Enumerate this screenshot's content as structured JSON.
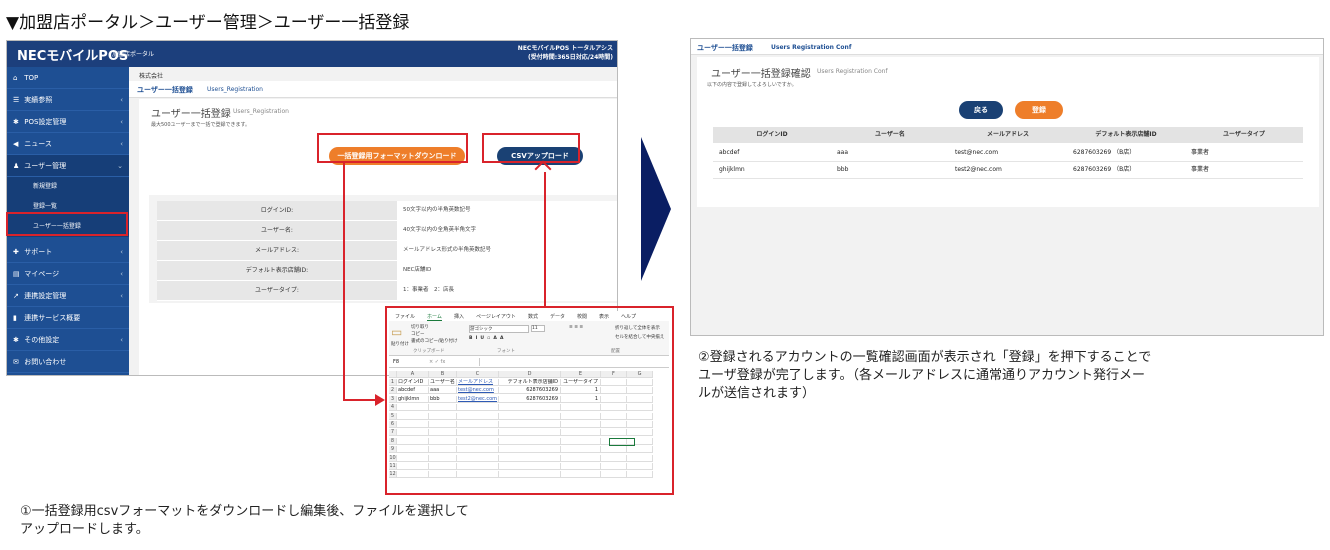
{
  "page_title": "▼加盟店ポータル＞ユーザー管理＞ユーザー一括登録",
  "left_app": {
    "logo": "NECモバイルPOS",
    "logo_sub": "加盟店ポータル",
    "top_right_line1": "NECモバイルPOS トータルアシス",
    "top_right_line2": "(受付時間:365日対応/24時間)",
    "sidebar": [
      {
        "icon": "home-icon",
        "glyph": "⌂",
        "label": "TOP",
        "chevron": ""
      },
      {
        "icon": "list-icon",
        "glyph": "☰",
        "label": "実績参照",
        "chevron": "‹"
      },
      {
        "icon": "gear-icon",
        "glyph": "✱",
        "label": "POS設定管理",
        "chevron": "‹"
      },
      {
        "icon": "megaphone-icon",
        "glyph": "◀",
        "label": "ニュース",
        "chevron": "‹"
      },
      {
        "icon": "users-icon",
        "glyph": "♟",
        "label": "ユーザー管理",
        "chevron": "⌄"
      }
    ],
    "sidebar_sub": [
      "新規登録",
      "登録一覧",
      "ユーザー一括登録"
    ],
    "sidebar_bottom": [
      {
        "icon": "support-icon",
        "glyph": "✚",
        "label": "サポート",
        "chevron": "‹"
      },
      {
        "icon": "id-card-icon",
        "glyph": "▤",
        "label": "マイページ",
        "chevron": "‹"
      },
      {
        "icon": "external-link-icon",
        "glyph": "↗",
        "label": "連携設定管理",
        "chevron": "‹"
      },
      {
        "icon": "document-icon",
        "glyph": "▮",
        "label": "連携サービス概要",
        "chevron": ""
      },
      {
        "icon": "gear-icon",
        "glyph": "✱",
        "label": "その他設定",
        "chevron": "‹"
      },
      {
        "icon": "mail-icon",
        "glyph": "✉",
        "label": "お問い合わせ",
        "chevron": ""
      }
    ],
    "company": "株式会社",
    "breadcrumb_main": "ユーザー一括登録",
    "breadcrumb_sub": "Users_Registration",
    "heading": "ユーザー一括登録",
    "heading_sub": "Users_Registration",
    "description": "最大500ユーザーまで一括で登録できます。",
    "btn_download": "一括登録用フォーマットダウンロード",
    "btn_csv": "CSVアップロード",
    "spec_rows": [
      {
        "label": "ログインID:",
        "value": "50文字以内の半角英数記号"
      },
      {
        "label": "ユーザー名:",
        "value": "40文字以内の全角英半角文字"
      },
      {
        "label": "メールアドレス:",
        "value": "メールアドレス形式の半角英数記号"
      },
      {
        "label": "デフォルト表示店舗ID:",
        "value": "NEC店舗ID"
      },
      {
        "label": "ユーザータイプ:",
        "value": "1：事業者　2：店長"
      }
    ]
  },
  "excel": {
    "tabs": [
      "ファイル",
      "ホーム",
      "挿入",
      "ページレイアウト",
      "数式",
      "データ",
      "校閲",
      "表示",
      "ヘルプ"
    ],
    "ribbon": {
      "cut": "切り取り",
      "copy": "コピー",
      "format_painter": "書式のコピー/貼り付け",
      "paste": "貼り付け",
      "clipboard": "クリップボード",
      "font_name": "游ゴシック",
      "font_size": "11",
      "font_group": "フォント",
      "wrap": "折り返して全体を表示",
      "merge": "セルを結合して中央揃え",
      "align_group": "配置"
    },
    "name_box": "F8",
    "formula_icons": "× ✓ fx",
    "columns": [
      "",
      "A",
      "B",
      "C",
      "D",
      "E",
      "F",
      "G"
    ],
    "rows": [
      [
        "1",
        "ログインID",
        "ユーザー名",
        "メールアドレス",
        "デフォルト表示店舗ID",
        "ユーザータイプ",
        "",
        ""
      ],
      [
        "2",
        "abcdef",
        "aaa",
        "test@nec.com",
        "6287603269",
        "1",
        "",
        ""
      ],
      [
        "3",
        "ghijklmn",
        "bbb",
        "test2@nec.com",
        "6287603269",
        "1",
        "",
        ""
      ],
      [
        "4",
        "",
        "",
        "",
        "",
        "",
        "",
        ""
      ],
      [
        "5",
        "",
        "",
        "",
        "",
        "",
        "",
        ""
      ],
      [
        "6",
        "",
        "",
        "",
        "",
        "",
        "",
        ""
      ],
      [
        "7",
        "",
        "",
        "",
        "",
        "",
        "",
        ""
      ],
      [
        "8",
        "",
        "",
        "",
        "",
        "",
        "",
        ""
      ],
      [
        "9",
        "",
        "",
        "",
        "",
        "",
        "",
        ""
      ],
      [
        "10",
        "",
        "",
        "",
        "",
        "",
        "",
        ""
      ],
      [
        "11",
        "",
        "",
        "",
        "",
        "",
        "",
        ""
      ],
      [
        "12",
        "",
        "",
        "",
        "",
        "",
        "",
        ""
      ]
    ]
  },
  "right_app": {
    "breadcrumb_main": "ユーザー一括登録",
    "breadcrumb_sub": "Users Registration Conf",
    "heading": "ユーザー一括登録確認",
    "heading_sub": "Users Registration Conf",
    "description": "以下の内容で登録してよろしいですか。",
    "btn_back": "戻る",
    "btn_register": "登録",
    "headers": [
      "ログインID",
      "ユーザー名",
      "メールアドレス",
      "デフォルト表示店舗ID",
      "ユーザータイプ"
    ],
    "rows": [
      [
        "abcdef",
        "aaa",
        "test@nec.com",
        "6287603269 （B店）",
        "事業者"
      ],
      [
        "ghijklmn",
        "bbb",
        "test2@nec.com",
        "6287603269 （B店）",
        "事業者"
      ]
    ]
  },
  "captions": {
    "left_line1": "①一括登録用csvフォーマットをダウンロードし編集後、ファイルを選択して",
    "left_line2": "アップロードします。",
    "right_line1": "②登録されるアカウントの一覧確認画面が表示され「登録」を押下することで",
    "right_line2": "ユーザ登録が完了します。（各メールアドレスに通常通りアカウント発行メー",
    "right_line3": "ルが送信されます）"
  },
  "colors": {
    "navy": "#1c3f7c",
    "sidebar": "#1e4f93",
    "orange": "#ee7e2a",
    "red": "#d9232b",
    "arrow": "#0a1e63"
  }
}
